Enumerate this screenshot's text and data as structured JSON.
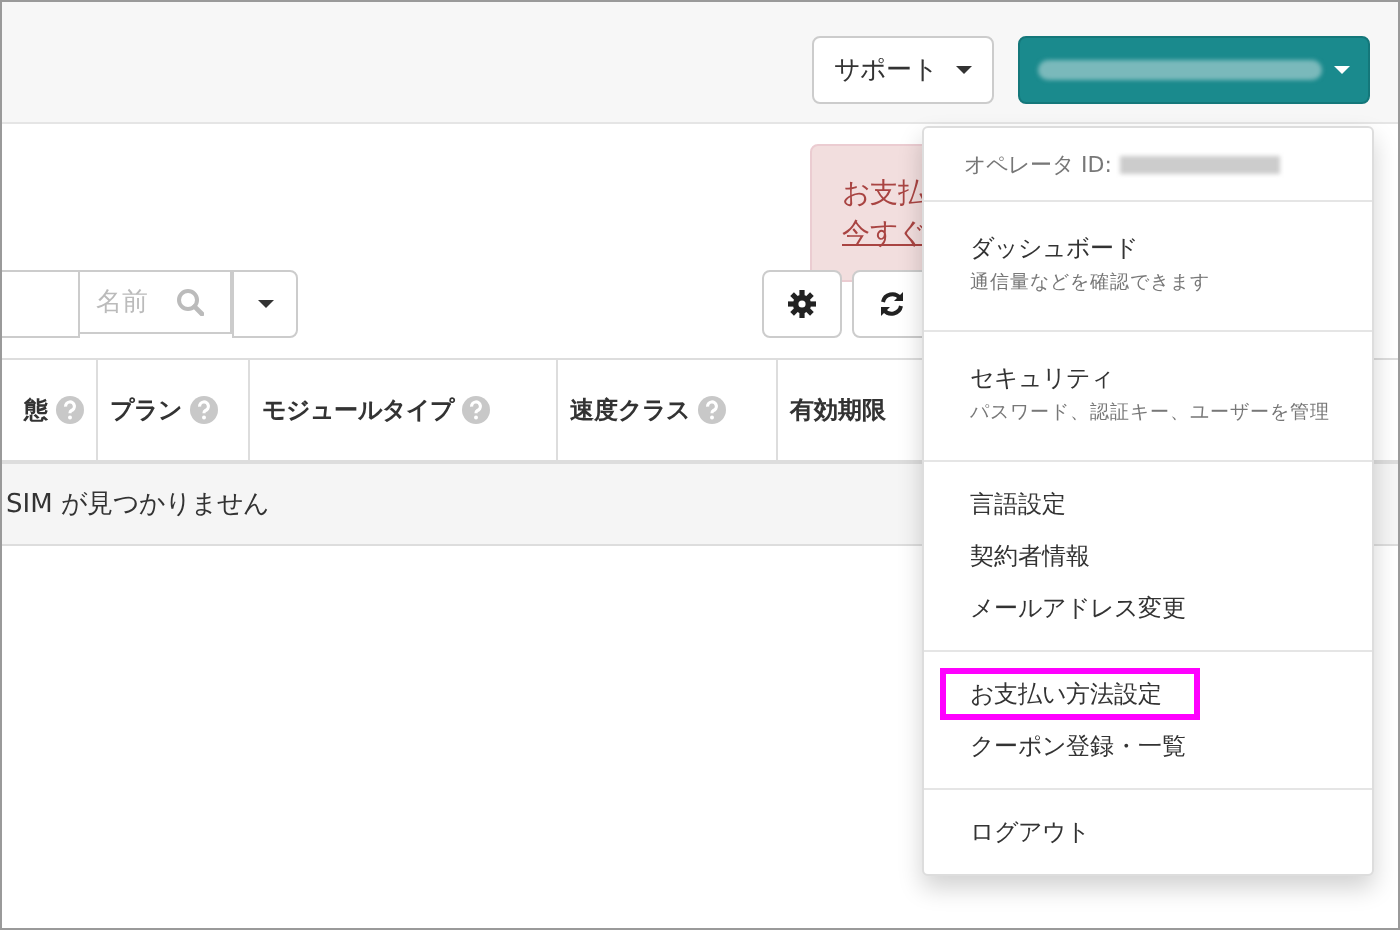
{
  "header": {
    "support_button": {
      "label": "サポート"
    },
    "account_button": {
      "redacted": true
    }
  },
  "alert": {
    "lines": [
      {
        "text": "お支払",
        "kind": "text"
      },
      {
        "text": "今すぐ",
        "kind": "link"
      }
    ]
  },
  "search": {
    "placeholder": "名前"
  },
  "table": {
    "columns": [
      {
        "label": "態",
        "help": true
      },
      {
        "label": "プラン",
        "help": true
      },
      {
        "label": "モジュールタイプ",
        "help": true
      },
      {
        "label": "速度クラス",
        "help": true
      },
      {
        "label": "有効期限",
        "help": false
      }
    ],
    "empty_message": "SIM が見つかりません"
  },
  "account_menu": {
    "operator_label": "オペレータ ID:",
    "operator_id_redacted": true,
    "groups": [
      [
        {
          "label": "ダッシュボード",
          "description": "通信量などを確認できます",
          "highlighted": false
        }
      ],
      [
        {
          "label": "セキュリティ",
          "description": "パスワード、認証キー、ユーザーを管理",
          "highlighted": false
        }
      ],
      [
        {
          "label": "言語設定",
          "highlighted": false
        },
        {
          "label": "契約者情報",
          "highlighted": false
        },
        {
          "label": "メールアドレス変更",
          "highlighted": false
        }
      ],
      [
        {
          "label": "お支払い方法設定",
          "highlighted": true
        },
        {
          "label": "クーポン登録・一覧",
          "highlighted": false
        }
      ],
      [
        {
          "label": "ログアウト",
          "highlighted": false
        }
      ]
    ]
  }
}
